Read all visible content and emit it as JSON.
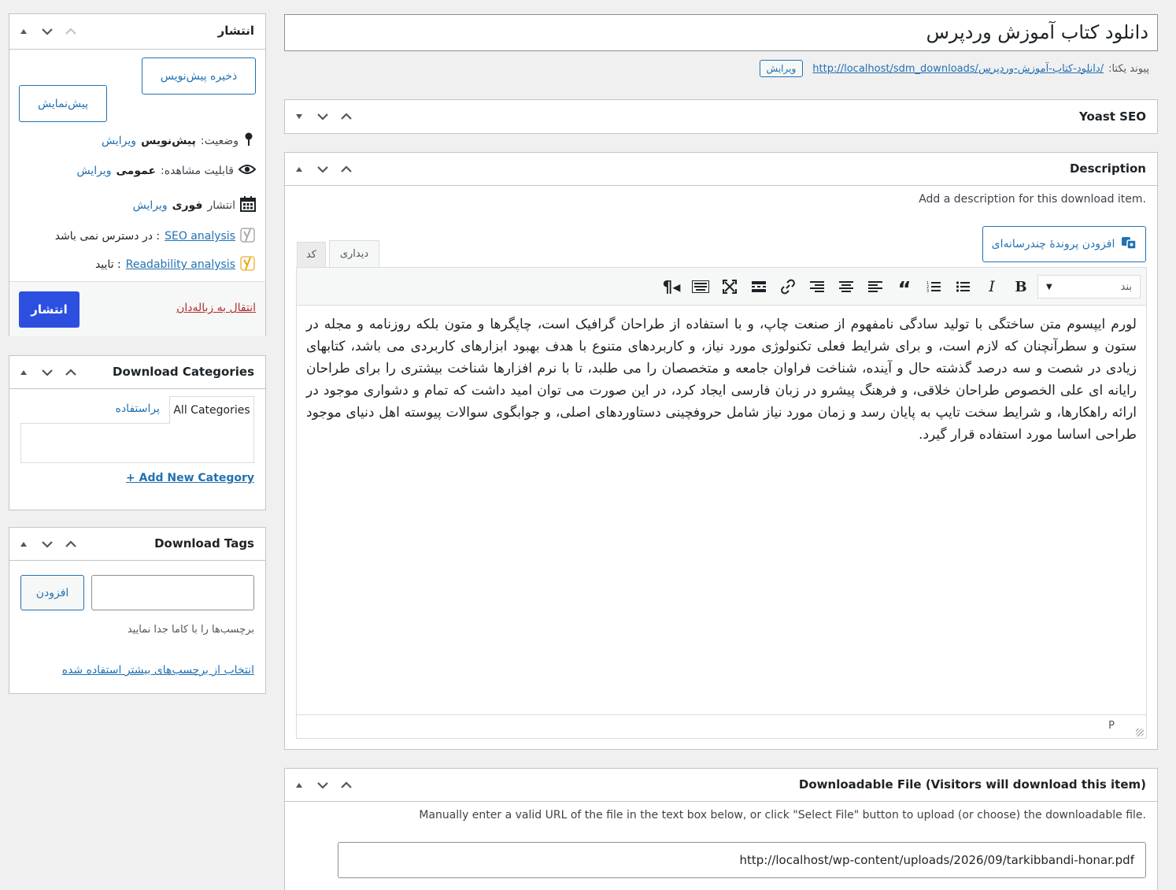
{
  "title": {
    "value": "دانلود کتاب آموزش وردپرس"
  },
  "permalink": {
    "label": "پیوند یکتا:",
    "url": "http://localhost/sdm_downloads/دانلود-کتاب-آموزش-وردپرس/",
    "edit_button": "ویرایش"
  },
  "yoast": {
    "title": "Yoast SEO"
  },
  "description": {
    "title": "Description",
    "help": "Add a description for this download item.",
    "add_media": "افزودن پروندهٔ چندرسانه‌ای",
    "tab_visual": "دیداری",
    "tab_code": "کد",
    "format_select": "بند",
    "content": "لورم ایپسوم متن ساختگی با تولید سادگی نامفهوم از صنعت چاپ، و با استفاده از طراحان گرافیک است، چاپگرها و متون بلکه روزنامه و مجله در ستون و سطرآنچنان که لازم است، و برای شرایط فعلی تکنولوژی مورد نیاز، و کاربردهای متنوع با هدف بهبود ابزارهای کاربردی می باشد، کتابهای زیادی در شصت و سه درصد گذشته حال و آینده، شناخت فراوان جامعه و متخصصان را می طلبد، تا با نرم افزارها شناخت بیشتری را برای طراحان رایانه ای علی الخصوص طراحان خلاقی، و فرهنگ پیشرو در زبان فارسی ایجاد کرد، در این صورت می توان امید داشت که تمام و دشواری موجود در ارائه راهکارها، و شرایط سخت تایپ به پایان رسد و زمان مورد نیاز شامل حروفچینی دستاوردهای اصلی، و جوابگوی سوالات پیوسته اهل دنیای موجود طراحی اساسا مورد استفاده قرار گیرد.",
    "path": "P"
  },
  "downloadable": {
    "title": "Downloadable File (Visitors will download this item)",
    "help": "Manually enter a valid URL of the file in the text box below, or click \"Select File\" button to upload (or choose) the downloadable file.",
    "url": "http://localhost/wp-content/uploads/2026/09/tarkibbandi-honar.pdf"
  },
  "publish": {
    "title": "انتشار",
    "save_draft": "ذخیره پیش‌نویس",
    "preview": "پیش‌نمایش",
    "status_label": "وضعیت:",
    "status_value": "پیش‌نویس",
    "visibility_label": "قابلیت مشاهده:",
    "visibility_value": "عمومی",
    "publish_label": "انتشار",
    "publish_value": "فوری",
    "edit": "ویرایش",
    "seo_link": "SEO analysis",
    "seo_value": ": در دسترس نمی باشد",
    "readability_link": "Readability analysis",
    "readability_value": ": تایید",
    "trash": "انتقال به زباله‌دان",
    "publish_button": "انتشار"
  },
  "categories": {
    "title": "Download Categories",
    "tab_all": "All Categories",
    "tab_popular": "پراستفاده",
    "add_new": "+ Add New Category"
  },
  "tags": {
    "title": "Download Tags",
    "add_button": "افزودن",
    "hint": "برچسب‌ها را با کاما جدا نمایید",
    "choose": "انتخاب از برچسب‌های بیشتر استفاده شده"
  },
  "colors": {
    "accent": "#2271b1",
    "primary_button": "#2c4fe0",
    "trash": "#b32d2e"
  }
}
